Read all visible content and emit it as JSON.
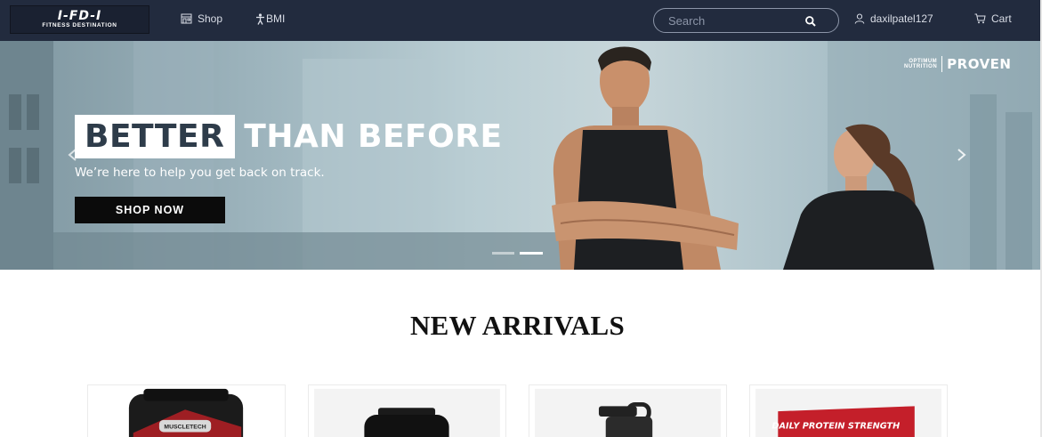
{
  "navbar": {
    "logo_mark": "I-FD-I",
    "logo_text": "FITNESS DESTINATION",
    "shop_label": "Shop",
    "bmi_label": "BMI",
    "search_placeholder": "Search",
    "username": "daxilpatel127",
    "cart_label": "Cart",
    "icons": [
      "store-icon",
      "person-icon",
      "search-icon",
      "user-icon",
      "cart-icon"
    ]
  },
  "hero": {
    "headline_boxed": "BETTER",
    "headline_rest": "THAN BEFORE",
    "subtitle": "We’re here to help you get back on track.",
    "cta_label": "SHOP NOW",
    "brand_small_1": "OPTIMUM",
    "brand_small_2": "NUTRITION",
    "brand_big": "PROVEN",
    "slides": 2,
    "active_slide": 2
  },
  "new_arrivals": {
    "title": "NEW ARRIVALS",
    "product_visible_text": [
      "MUSCLETECH",
      "DAILY PROTEIN STRENGTH"
    ]
  },
  "colors": {
    "navbar_bg": "#222b3e",
    "cta_bg": "#0b0b0b",
    "headline_text": "#2e3c4a",
    "bar_red": "#c41f2a"
  }
}
